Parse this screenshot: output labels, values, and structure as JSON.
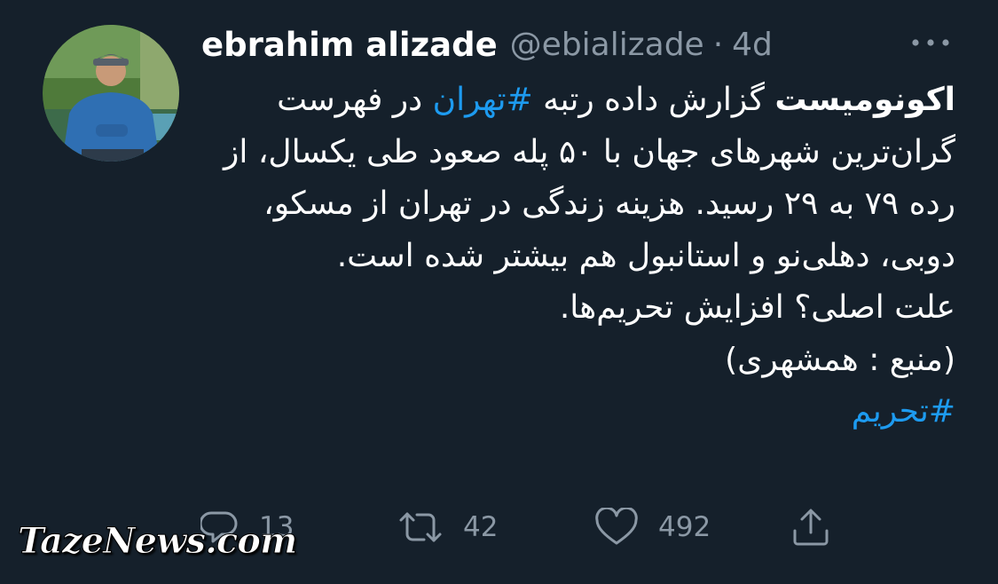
{
  "tweet": {
    "author_name": "ebrahim alizade",
    "author_handle": "@ebializade",
    "separator": "·",
    "timestamp": "4d",
    "text": {
      "line1_bold": "اکونومیست",
      "line1_mid": " گزارش داده رتبه ",
      "hashtag_tehran": "#تهران",
      "line1_end": " در فهرست گران‌ترین شهرهای جهان با ۵۰ پله صعود طی یکسال، از رده ۷۹ به ۲۹ رسید. هزینه زندگی در تهران از مسکو، دوبی، دهلی‌نو و استانبول هم بیشتر شده است.",
      "line2": "علت اصلی؟ افزایش تحریم‌ها.",
      "line3": "(منبع : همشهری)",
      "hashtag_sanctions": "#تحریم"
    }
  },
  "actions": {
    "replies": "13",
    "retweets": "42",
    "likes": "492"
  },
  "icons": {
    "more": "more-options-icon",
    "reply": "reply-icon",
    "retweet": "retweet-icon",
    "like": "heart-icon",
    "share": "share-icon"
  },
  "colors": {
    "background": "#15202b",
    "text": "#ffffff",
    "muted": "#8b98a5",
    "accent": "#1d9bf0"
  },
  "watermark": "TazeNews.com"
}
